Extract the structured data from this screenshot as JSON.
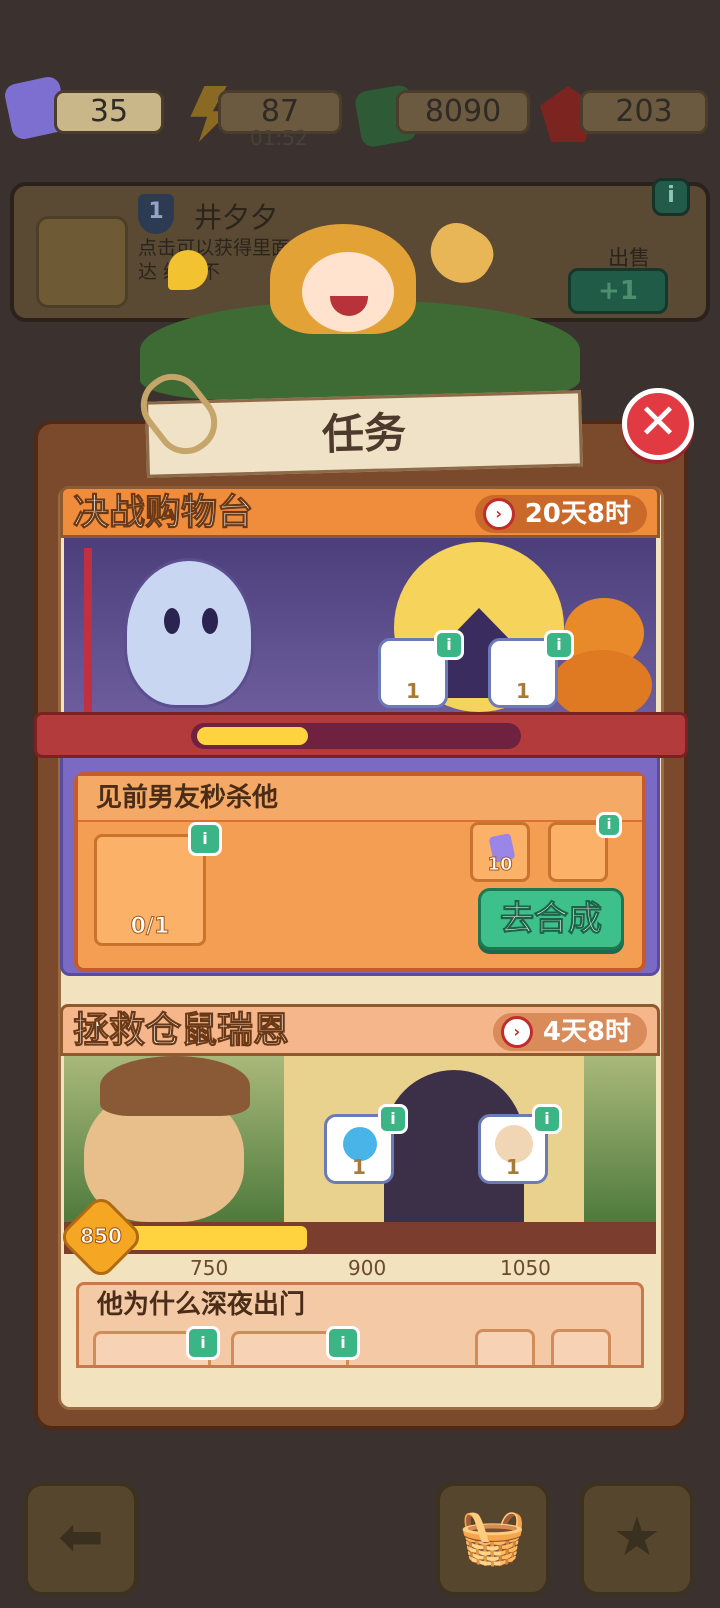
{
  "resources": {
    "tickets": "35",
    "energy": "87",
    "energy_timer": "01:52",
    "cash": "8090",
    "gems": "203"
  },
  "background_card": {
    "level": "1",
    "name": "井夕夕",
    "desc": "点击可以获得里面 已达   级，不",
    "sell_label": "出售",
    "sell_amount": "+1",
    "info": "i"
  },
  "modal": {
    "title": "任务",
    "close_symbol": "✕"
  },
  "quests": [
    {
      "name": "决战购物台",
      "time_left": "20天8时",
      "rewards": [
        {
          "count": "1"
        },
        {
          "count": "1"
        }
      ],
      "progress": 0.35,
      "task": {
        "title": "见前男友秒杀他",
        "slot_progress": "0/1",
        "cost": "10",
        "button": "去合成"
      }
    },
    {
      "name": "拯救仓鼠瑞恩",
      "time_left": "4天8时",
      "rewards": [
        {
          "count": "1"
        },
        {
          "count": "1"
        }
      ],
      "current": "850",
      "milestones": [
        "750",
        "900",
        "1050"
      ],
      "task": {
        "title": "他为什么深夜出门"
      }
    }
  ],
  "icons": {
    "info": "i",
    "clock": "›"
  },
  "colors": {
    "close": "#e23a42",
    "go_button": "#3ec08a",
    "progress": "#ffd23f",
    "quest1_header": "#f08d3c",
    "quest2_header": "#f4b68a"
  }
}
